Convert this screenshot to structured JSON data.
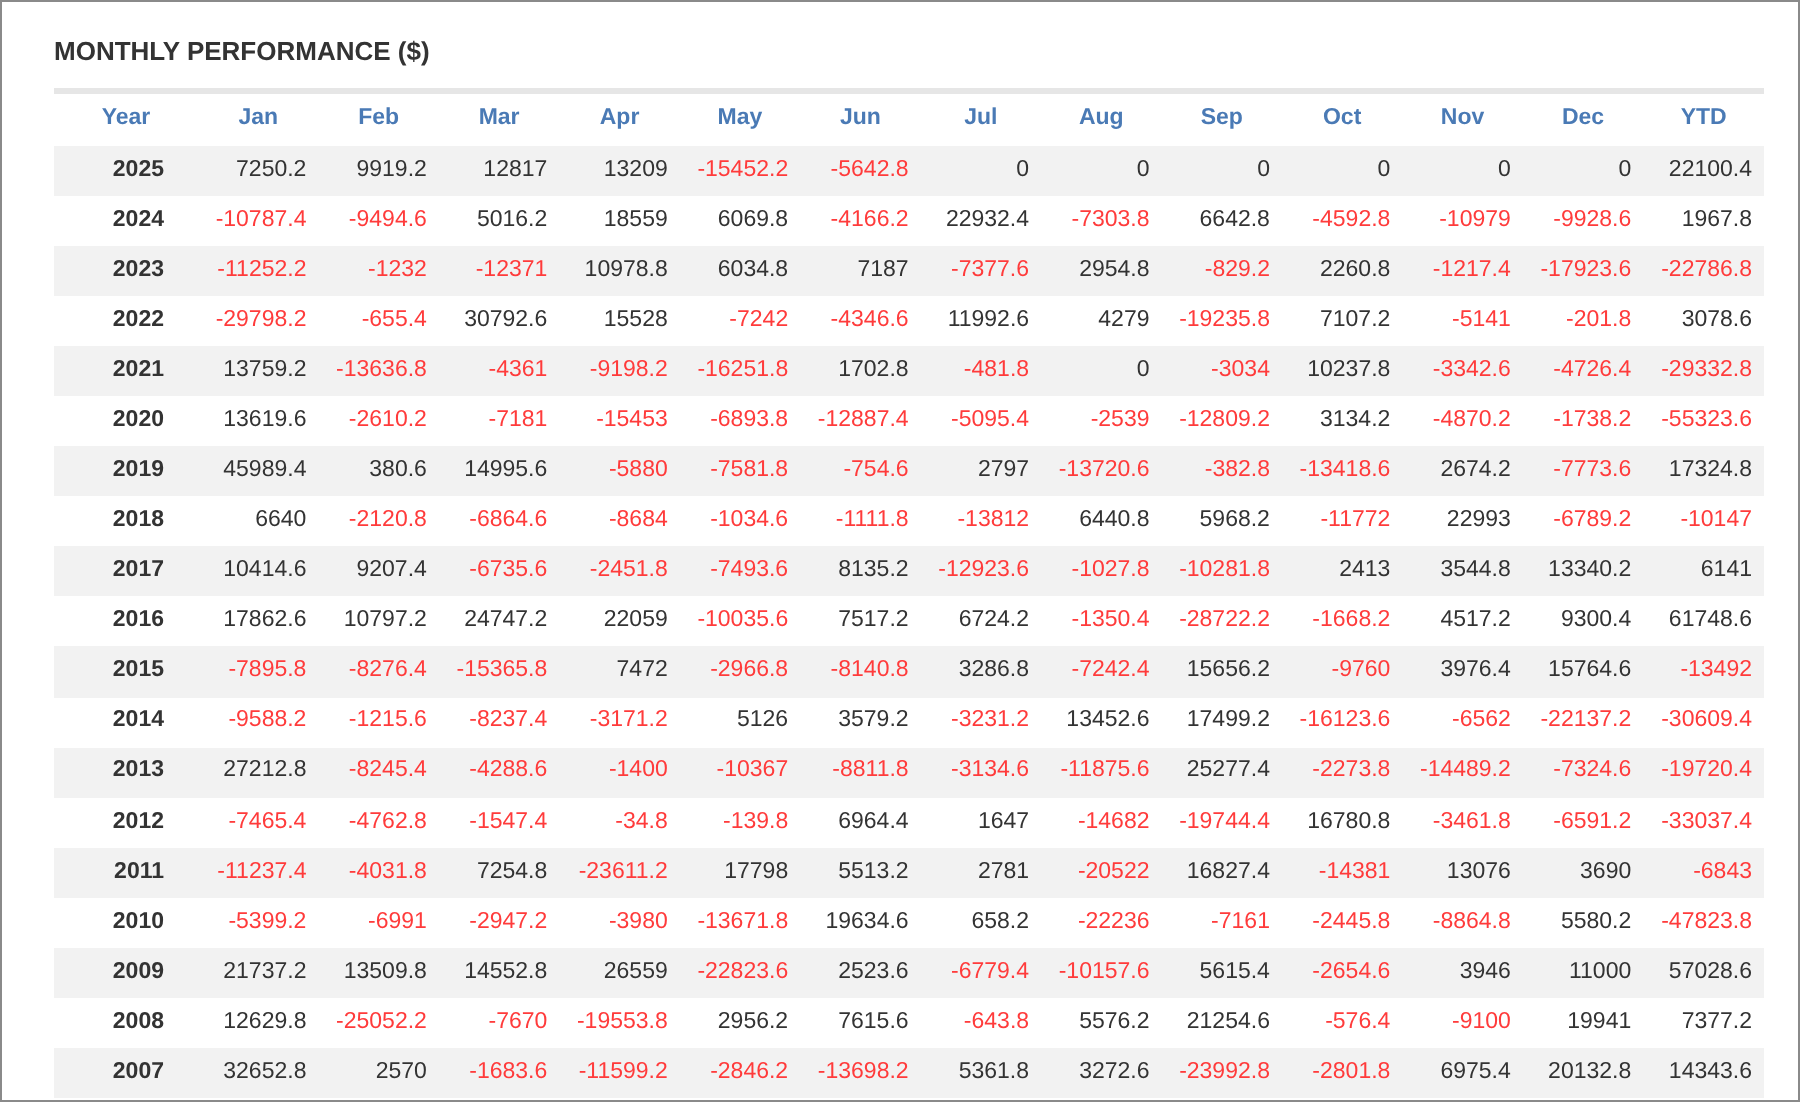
{
  "title": "MONTHLY PERFORMANCE ($)",
  "table": {
    "columns": [
      "Year",
      "Jan",
      "Feb",
      "Mar",
      "Apr",
      "May",
      "Jun",
      "Jul",
      "Aug",
      "Sep",
      "Oct",
      "Nov",
      "Dec",
      "YTD"
    ],
    "rows": [
      {
        "year": "2025",
        "values": [
          "7250.2",
          "9919.2",
          "12817",
          "13209",
          "-15452.2",
          "-5642.8",
          "0",
          "0",
          "0",
          "0",
          "0",
          "0",
          "22100.4"
        ],
        "negative": [
          false,
          false,
          false,
          false,
          true,
          true,
          false,
          false,
          false,
          false,
          false,
          false,
          false
        ]
      },
      {
        "year": "2024",
        "values": [
          "-10787.4",
          "-9494.6",
          "5016.2",
          "18559",
          "6069.8",
          "-4166.2",
          "22932.4",
          "-7303.8",
          "6642.8",
          "-4592.8",
          "-10979",
          "-9928.6",
          "1967.8"
        ],
        "negative": [
          true,
          true,
          false,
          false,
          false,
          true,
          false,
          true,
          false,
          true,
          true,
          true,
          false
        ]
      },
      {
        "year": "2023",
        "values": [
          "-11252.2",
          "-1232",
          "-12371",
          "10978.8",
          "6034.8",
          "7187",
          "-7377.6",
          "2954.8",
          "-829.2",
          "2260.8",
          "-1217.4",
          "-17923.6",
          "-22786.8"
        ],
        "negative": [
          true,
          true,
          true,
          false,
          false,
          false,
          true,
          false,
          true,
          false,
          true,
          true,
          true
        ]
      },
      {
        "year": "2022",
        "values": [
          "-29798.2",
          "-655.4",
          "30792.6",
          "15528",
          "-7242",
          "-4346.6",
          "11992.6",
          "4279",
          "-19235.8",
          "7107.2",
          "-5141",
          "-201.8",
          "3078.6"
        ],
        "negative": [
          true,
          true,
          false,
          false,
          true,
          true,
          false,
          false,
          true,
          false,
          true,
          true,
          false
        ]
      },
      {
        "year": "2021",
        "values": [
          "13759.2",
          "-13636.8",
          "-4361",
          "-9198.2",
          "-16251.8",
          "1702.8",
          "-481.8",
          "0",
          "-3034",
          "10237.8",
          "-3342.6",
          "-4726.4",
          "-29332.8"
        ],
        "negative": [
          false,
          true,
          true,
          true,
          true,
          false,
          true,
          false,
          true,
          false,
          true,
          true,
          true
        ]
      },
      {
        "year": "2020",
        "values": [
          "13619.6",
          "-2610.2",
          "-7181",
          "-15453",
          "-6893.8",
          "-12887.4",
          "-5095.4",
          "-2539",
          "-12809.2",
          "3134.2",
          "-4870.2",
          "-1738.2",
          "-55323.6"
        ],
        "negative": [
          false,
          true,
          true,
          true,
          true,
          true,
          true,
          true,
          true,
          false,
          true,
          true,
          true
        ]
      },
      {
        "year": "2019",
        "values": [
          "45989.4",
          "380.6",
          "14995.6",
          "-5880",
          "-7581.8",
          "-754.6",
          "2797",
          "-13720.6",
          "-382.8",
          "-13418.6",
          "2674.2",
          "-7773.6",
          "17324.8"
        ],
        "negative": [
          false,
          false,
          false,
          true,
          true,
          true,
          false,
          true,
          true,
          true,
          false,
          true,
          false
        ]
      },
      {
        "year": "2018",
        "values": [
          "6640",
          "-2120.8",
          "-6864.6",
          "-8684",
          "-1034.6",
          "-1111.8",
          "-13812",
          "6440.8",
          "5968.2",
          "-11772",
          "22993",
          "-6789.2",
          "-10147"
        ],
        "negative": [
          false,
          true,
          true,
          true,
          true,
          true,
          true,
          false,
          false,
          true,
          false,
          true,
          true
        ]
      },
      {
        "year": "2017",
        "values": [
          "10414.6",
          "9207.4",
          "-6735.6",
          "-2451.8",
          "-7493.6",
          "8135.2",
          "-12923.6",
          "-1027.8",
          "-10281.8",
          "2413",
          "3544.8",
          "13340.2",
          "6141"
        ],
        "negative": [
          false,
          false,
          true,
          true,
          true,
          false,
          true,
          true,
          true,
          false,
          false,
          false,
          false
        ]
      },
      {
        "year": "2016",
        "values": [
          "17862.6",
          "10797.2",
          "24747.2",
          "22059",
          "-10035.6",
          "7517.2",
          "6724.2",
          "-1350.4",
          "-28722.2",
          "-1668.2",
          "4517.2",
          "9300.4",
          "61748.6"
        ],
        "negative": [
          false,
          false,
          false,
          false,
          true,
          false,
          false,
          true,
          true,
          true,
          false,
          false,
          false
        ]
      },
      {
        "year": "2015",
        "values": [
          "-7895.8",
          "-8276.4",
          "-15365.8",
          "7472",
          "-2966.8",
          "-8140.8",
          "3286.8",
          "-7242.4",
          "15656.2",
          "-9760",
          "3976.4",
          "15764.6",
          "-13492"
        ],
        "negative": [
          true,
          true,
          true,
          false,
          true,
          true,
          false,
          true,
          false,
          true,
          false,
          false,
          true
        ]
      },
      {
        "year": "2014",
        "values": [
          "-9588.2",
          "-1215.6",
          "-8237.4",
          "-3171.2",
          "5126",
          "3579.2",
          "-3231.2",
          "13452.6",
          "17499.2",
          "-16123.6",
          "-6562",
          "-22137.2",
          "-30609.4"
        ],
        "negative": [
          true,
          true,
          true,
          true,
          false,
          false,
          true,
          false,
          false,
          true,
          true,
          true,
          true
        ]
      },
      {
        "year": "2013",
        "values": [
          "27212.8",
          "-8245.4",
          "-4288.6",
          "-1400",
          "-10367",
          "-8811.8",
          "-3134.6",
          "-11875.6",
          "25277.4",
          "-2273.8",
          "-14489.2",
          "-7324.6",
          "-19720.4"
        ],
        "negative": [
          false,
          true,
          true,
          true,
          true,
          true,
          true,
          true,
          false,
          true,
          true,
          true,
          true
        ]
      },
      {
        "year": "2012",
        "values": [
          "-7465.4",
          "-4762.8",
          "-1547.4",
          "-34.8",
          "-139.8",
          "6964.4",
          "1647",
          "-14682",
          "-19744.4",
          "16780.8",
          "-3461.8",
          "-6591.2",
          "-33037.4"
        ],
        "negative": [
          true,
          true,
          true,
          true,
          true,
          false,
          false,
          true,
          true,
          false,
          true,
          true,
          true
        ]
      },
      {
        "year": "2011",
        "values": [
          "-11237.4",
          "-4031.8",
          "7254.8",
          "-23611.2",
          "17798",
          "5513.2",
          "2781",
          "-20522",
          "16827.4",
          "-14381",
          "13076",
          "3690",
          "-6843"
        ],
        "negative": [
          true,
          true,
          false,
          true,
          false,
          false,
          false,
          true,
          false,
          true,
          false,
          false,
          true
        ]
      },
      {
        "year": "2010",
        "values": [
          "-5399.2",
          "-6991",
          "-2947.2",
          "-3980",
          "-13671.8",
          "19634.6",
          "658.2",
          "-22236",
          "-7161",
          "-2445.8",
          "-8864.8",
          "5580.2",
          "-47823.8"
        ],
        "negative": [
          true,
          true,
          true,
          true,
          true,
          false,
          false,
          true,
          true,
          true,
          true,
          false,
          true
        ]
      },
      {
        "year": "2009",
        "values": [
          "21737.2",
          "13509.8",
          "14552.8",
          "26559",
          "-22823.6",
          "2523.6",
          "-6779.4",
          "-10157.6",
          "5615.4",
          "-2654.6",
          "3946",
          "11000",
          "57028.6"
        ],
        "negative": [
          false,
          false,
          false,
          false,
          true,
          false,
          true,
          true,
          false,
          true,
          false,
          false,
          false
        ]
      },
      {
        "year": "2008",
        "values": [
          "12629.8",
          "-25052.2",
          "-7670",
          "-19553.8",
          "2956.2",
          "7615.6",
          "-643.8",
          "5576.2",
          "21254.6",
          "-576.4",
          "-9100",
          "19941",
          "7377.2"
        ],
        "negative": [
          false,
          true,
          true,
          true,
          false,
          false,
          true,
          false,
          false,
          true,
          true,
          false,
          false
        ]
      },
      {
        "year": "2007",
        "values": [
          "32652.8",
          "2570",
          "-1683.6",
          "-11599.2",
          "-2846.2",
          "-13698.2",
          "5361.8",
          "3272.6",
          "-23992.8",
          "-2801.8",
          "6975.4",
          "20132.8",
          "14343.6"
        ],
        "negative": [
          false,
          false,
          true,
          true,
          true,
          true,
          false,
          false,
          true,
          true,
          false,
          false,
          false
        ]
      }
    ]
  }
}
